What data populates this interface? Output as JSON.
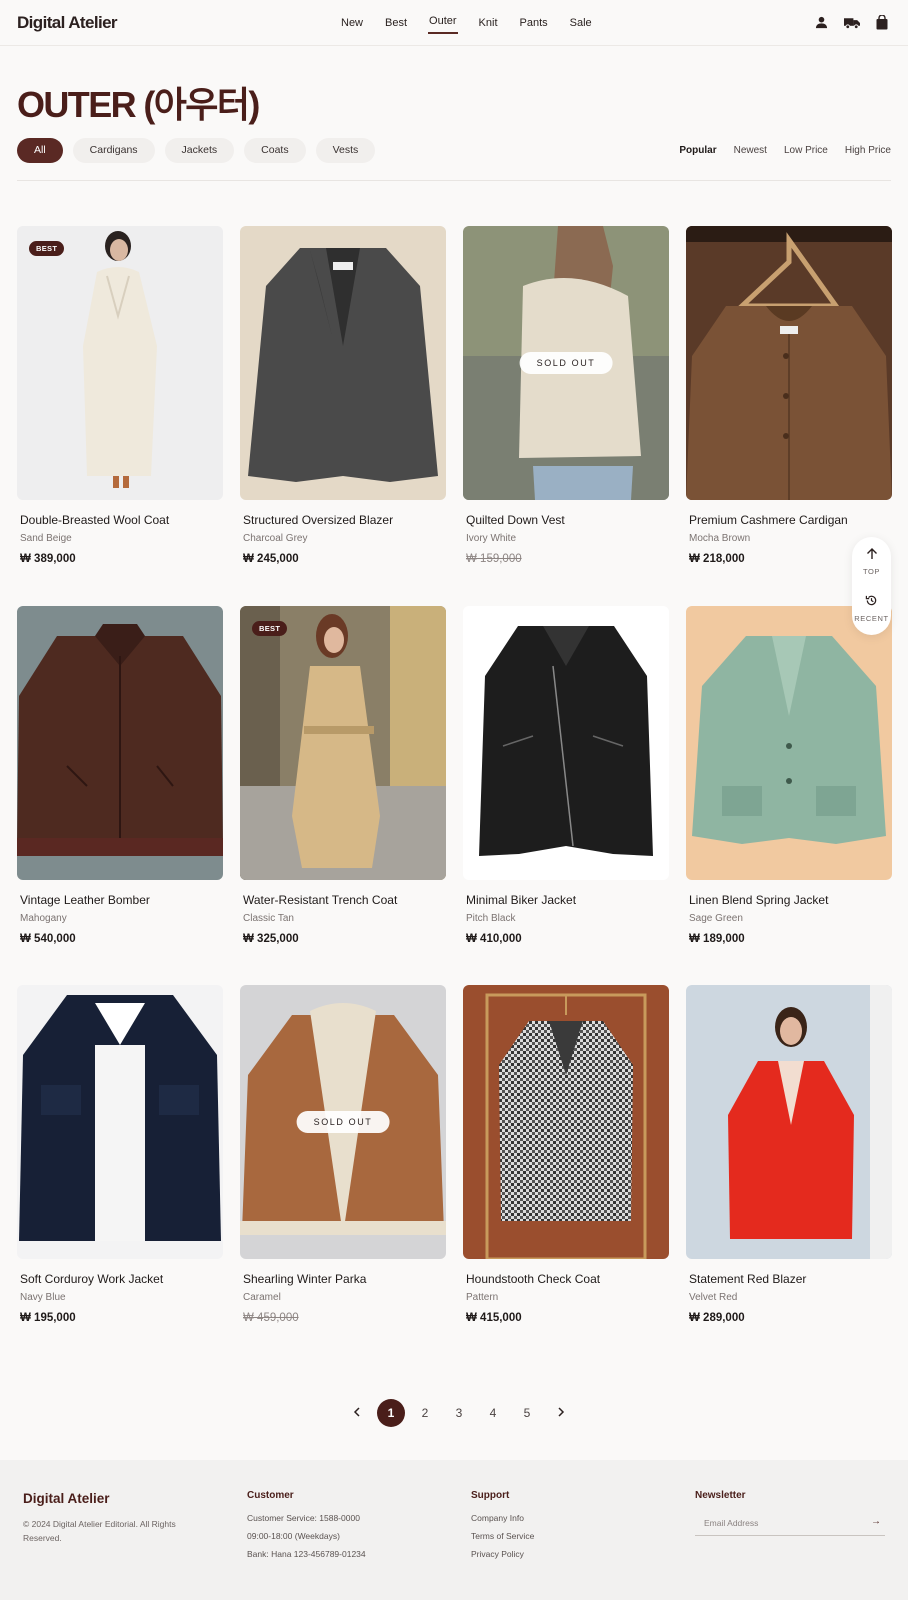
{
  "header": {
    "logo": "Digital Atelier",
    "nav": [
      {
        "label": "New"
      },
      {
        "label": "Best"
      },
      {
        "label": "Outer",
        "active": true
      },
      {
        "label": "Knit"
      },
      {
        "label": "Pants"
      },
      {
        "label": "Sale"
      }
    ],
    "icons": [
      "user-icon",
      "truck-icon",
      "shopping-bag-icon"
    ]
  },
  "page_title": "OUTER (아우터)",
  "filters": [
    "All",
    "Cardigans",
    "Jackets",
    "Coats",
    "Vests"
  ],
  "active_filter": "All",
  "sorts": [
    "Popular",
    "Newest",
    "Low Price",
    "High Price"
  ],
  "active_sort": "Popular",
  "products": [
    {
      "name": "Double-Breasted Wool Coat",
      "color": "Sand Beige",
      "price": "₩ 389,000",
      "badge": "BEST",
      "sold_out": false
    },
    {
      "name": "Structured Oversized Blazer",
      "color": "Charcoal Grey",
      "price": "₩ 245,000",
      "sold_out": false
    },
    {
      "name": "Quilted Down Vest",
      "color": "Ivory White",
      "price": "₩ 159,000",
      "sold_out": true,
      "sold_out_label": "SOLD OUT"
    },
    {
      "name": "Premium Cashmere Cardigan",
      "color": "Mocha Brown",
      "price": "₩ 218,000",
      "sold_out": false
    },
    {
      "name": "Vintage Leather Bomber",
      "color": "Mahogany",
      "price": "₩ 540,000",
      "sold_out": false
    },
    {
      "name": "Water-Resistant Trench Coat",
      "color": "Classic Tan",
      "price": "₩ 325,000",
      "badge": "BEST",
      "sold_out": false
    },
    {
      "name": "Minimal Biker Jacket",
      "color": "Pitch Black",
      "price": "₩ 410,000",
      "sold_out": false
    },
    {
      "name": "Linen Blend Spring Jacket",
      "color": "Sage Green",
      "price": "₩ 189,000",
      "sold_out": false
    },
    {
      "name": "Soft Corduroy Work Jacket",
      "color": "Navy Blue",
      "price": "₩ 195,000",
      "sold_out": false
    },
    {
      "name": "Shearling Winter Parka",
      "color": "Caramel",
      "price": "₩ 459,000",
      "sold_out": true,
      "sold_out_label": "SOLD OUT"
    },
    {
      "name": "Houndstooth Check Coat",
      "color": "Pattern",
      "price": "₩ 415,000",
      "sold_out": false
    },
    {
      "name": "Statement Red Blazer",
      "color": "Velvet Red",
      "price": "₩ 289,000",
      "sold_out": false
    }
  ],
  "floating": {
    "top_label": "TOP",
    "recent_label": "RECENT"
  },
  "pagination": {
    "pages": [
      "1",
      "2",
      "3",
      "4",
      "5"
    ],
    "current": "1"
  },
  "footer": {
    "brand": "Digital Atelier",
    "copyright": "© 2024 Digital Atelier Editorial. All Rights Reserved.",
    "customer": {
      "heading": "Customer",
      "lines": [
        "Customer Service: 1588-0000",
        "09:00-18:00 (Weekdays)",
        "Bank: Hana 123-456789-01234"
      ]
    },
    "support": {
      "heading": "Support",
      "links": [
        "Company Info",
        "Terms of Service",
        "Privacy Policy"
      ]
    },
    "newsletter": {
      "heading": "Newsletter",
      "placeholder": "Email Address"
    }
  },
  "colors": {
    "accent": "#4a1e1a",
    "background": "#faf9f8",
    "footer_bg": "#f2f1f0"
  }
}
